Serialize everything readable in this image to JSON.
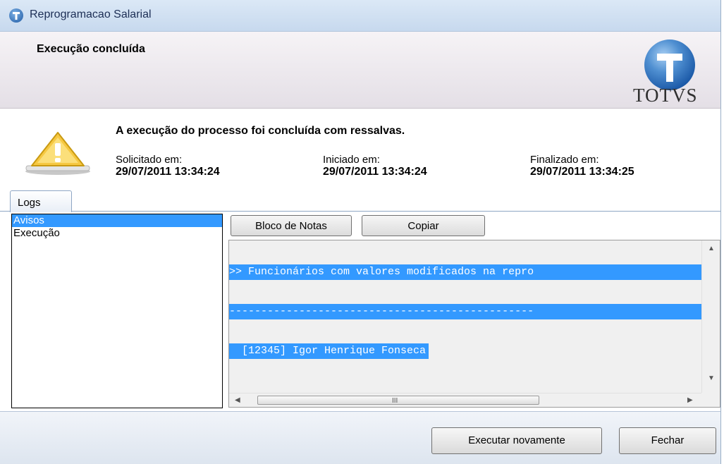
{
  "window": {
    "title": "Reprogramacao Salarial"
  },
  "header": {
    "title": "Execução concluída",
    "logo_text": "TOTVS"
  },
  "status": {
    "message": "A execução do processo foi concluída com ressalvas.",
    "requested_label": "Solicitado em:",
    "requested_value": "29/07/2011 13:34:24",
    "started_label": "Iniciado em:",
    "started_value": "29/07/2011 13:34:24",
    "finished_label": "Finalizado em:",
    "finished_value": "29/07/2011 13:34:25"
  },
  "tabs": [
    {
      "label": "Logs"
    }
  ],
  "log_list": [
    {
      "label": "Avisos",
      "selected": true
    },
    {
      "label": "Execução",
      "selected": false
    }
  ],
  "toolbar": {
    "notepad_label": "Bloco de Notas",
    "copy_label": "Copiar"
  },
  "log_text": {
    "line1": ">> Funcionários com valores modificados na repro",
    "line2": "------------------------------------------------",
    "line3": "  [12345] Igor Henrique Fonseca"
  },
  "scrollbar": {
    "grip": "III"
  },
  "footer": {
    "run_again_label": "Executar novamente",
    "close_label": "Fechar"
  },
  "colors": {
    "selection": "#3399ff",
    "title_bar": "#c7d9ee"
  }
}
